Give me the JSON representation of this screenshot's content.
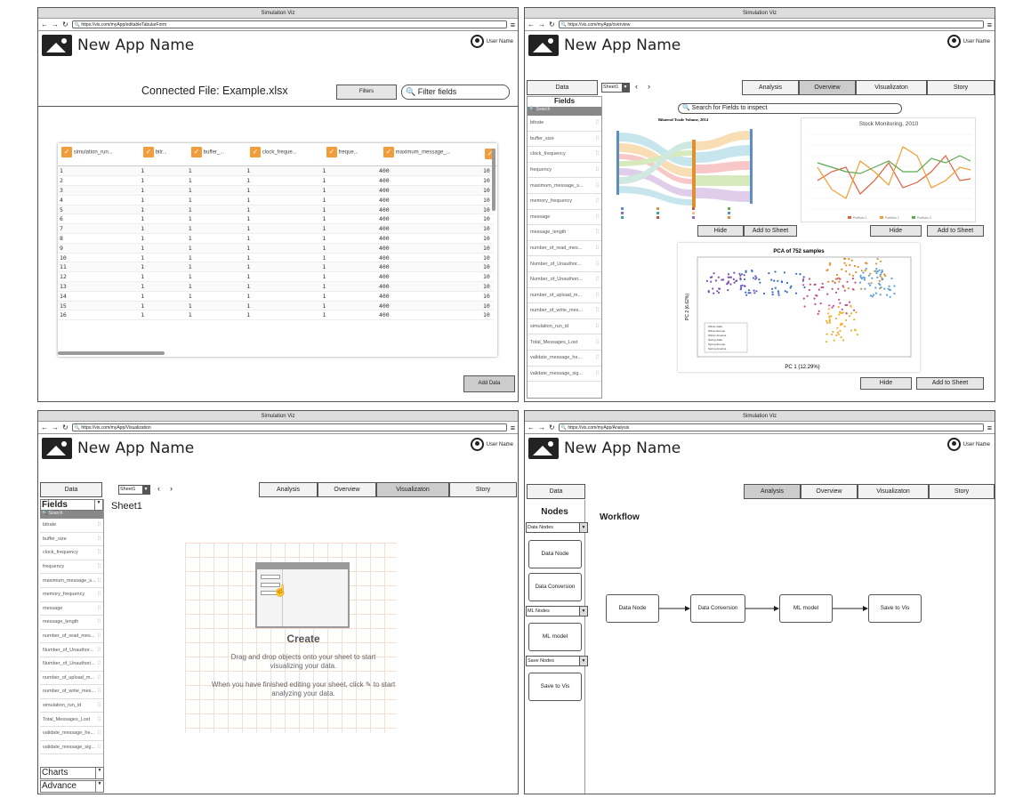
{
  "app": {
    "window_title": "Simulation Viz",
    "app_name": "New App Name",
    "user": "User Name"
  },
  "p1": {
    "url": "https://vis.com/myApp/editableTabularForm",
    "connected": "Connected File: Example.xlsx",
    "filters_btn": "Filters",
    "filter_placeholder": "Filter fields",
    "add_data": "Add Data",
    "columns": [
      "simulation_run...",
      "bitr...",
      "buffer_...",
      "clock_freque...",
      "freque...",
      "maximum_message_..."
    ],
    "rows": [
      [
        "1",
        "1",
        "1",
        "1",
        "1",
        "400",
        "10"
      ],
      [
        "2",
        "1",
        "1",
        "1",
        "1",
        "400",
        "10"
      ],
      [
        "3",
        "1",
        "1",
        "1",
        "1",
        "400",
        "10"
      ],
      [
        "4",
        "1",
        "1",
        "1",
        "1",
        "400",
        "10"
      ],
      [
        "5",
        "1",
        "1",
        "1",
        "1",
        "400",
        "10"
      ],
      [
        "6",
        "1",
        "1",
        "1",
        "1",
        "400",
        "10"
      ],
      [
        "7",
        "1",
        "1",
        "1",
        "1",
        "400",
        "10"
      ],
      [
        "8",
        "1",
        "1",
        "1",
        "1",
        "400",
        "10"
      ],
      [
        "9",
        "1",
        "1",
        "1",
        "1",
        "400",
        "10"
      ],
      [
        "10",
        "1",
        "1",
        "1",
        "1",
        "400",
        "10"
      ],
      [
        "11",
        "1",
        "1",
        "1",
        "1",
        "400",
        "10"
      ],
      [
        "12",
        "1",
        "1",
        "1",
        "1",
        "400",
        "10"
      ],
      [
        "13",
        "1",
        "1",
        "1",
        "1",
        "400",
        "10"
      ],
      [
        "14",
        "1",
        "1",
        "1",
        "1",
        "400",
        "10"
      ],
      [
        "15",
        "1",
        "1",
        "1",
        "1",
        "400",
        "10"
      ],
      [
        "16",
        "1",
        "1",
        "1",
        "1",
        "400",
        "10"
      ]
    ]
  },
  "p2": {
    "url": "https://vis.com/myApp/overview",
    "search": "Search for Fields to inspect",
    "fields_title": "Fields",
    "search_small": "Search",
    "fields": [
      "bitrate",
      "buffer_size",
      "clock_frequency",
      "frequency",
      "maximum_message_s...",
      "memory_frequency",
      "message",
      "message_length",
      "number_of_read_mes...",
      "Number_of_Unauthor...",
      "Number_of_Unauthori...",
      "number_of_upload_m...",
      "number_of_write_mes...",
      "simulation_run_id",
      "Total_Messages_Lost",
      "validate_message_he...",
      "validate_message_sig..."
    ],
    "sankey_title": "Bilateral Trade Volume, 2014",
    "stock_title": "Stock Monitoring, 2010",
    "stock_legend": [
      "Portfolio 1",
      "Portfolio 2",
      "Portfolio 3"
    ],
    "pca_title": "PCA of 752 samples",
    "pca_x": "PC 1 (12.29%)",
    "pca_y": "PC 2 (6.62%)",
    "pca_legend": [
      "Winter Aalto",
      "Winter Europe",
      "Winter America",
      "Spring Aalto",
      "Spring Europe",
      "Spring America"
    ],
    "hide": "Hide",
    "add_sheet": "Add to Sheet"
  },
  "p3": {
    "url": "https://vis.com/myApp/Visualization",
    "fields_title": "Fields",
    "sheet_title": "Sheet1",
    "create": "Create",
    "drag_text": "Drag and drop objects onto your sheet to start visualizing your data.",
    "finish_text": "When you have finished editing your sheet, click ✎ to start analyzing your data.",
    "charts": "Charts",
    "advance": "Advance",
    "search_small": "Search",
    "fields": [
      "bitrate",
      "buffer_size",
      "clock_frequency",
      "frequency",
      "maximum_message_s...",
      "memory_frequency",
      "message",
      "message_length",
      "number_of_read_mes...",
      "Number_of_Unauthor...",
      "Number_of_Unauthori...",
      "number_of_upload_m...",
      "number_of_write_mes...",
      "simulation_run_id",
      "Total_Messages_Lost",
      "validate_message_he...",
      "validate_message_sig..."
    ]
  },
  "p4": {
    "url": "https://vis.com/myApp/Analysis",
    "nodes_title": "Nodes",
    "workflow": "Workflow",
    "data_nodes": "Data Nodes",
    "ml_nodes": "ML Nodes",
    "save_nodes": "Save Nodes",
    "data_node": "Data Node",
    "data_conversion": "Data Conversion",
    "ml_model": "ML model",
    "save_vis": "Save to Vis"
  },
  "tabs": {
    "data": "Data",
    "sheet": "Sheet1",
    "analysis": "Analysis",
    "overview": "Overview",
    "visualization": "Visualizaton",
    "story": "Story"
  }
}
